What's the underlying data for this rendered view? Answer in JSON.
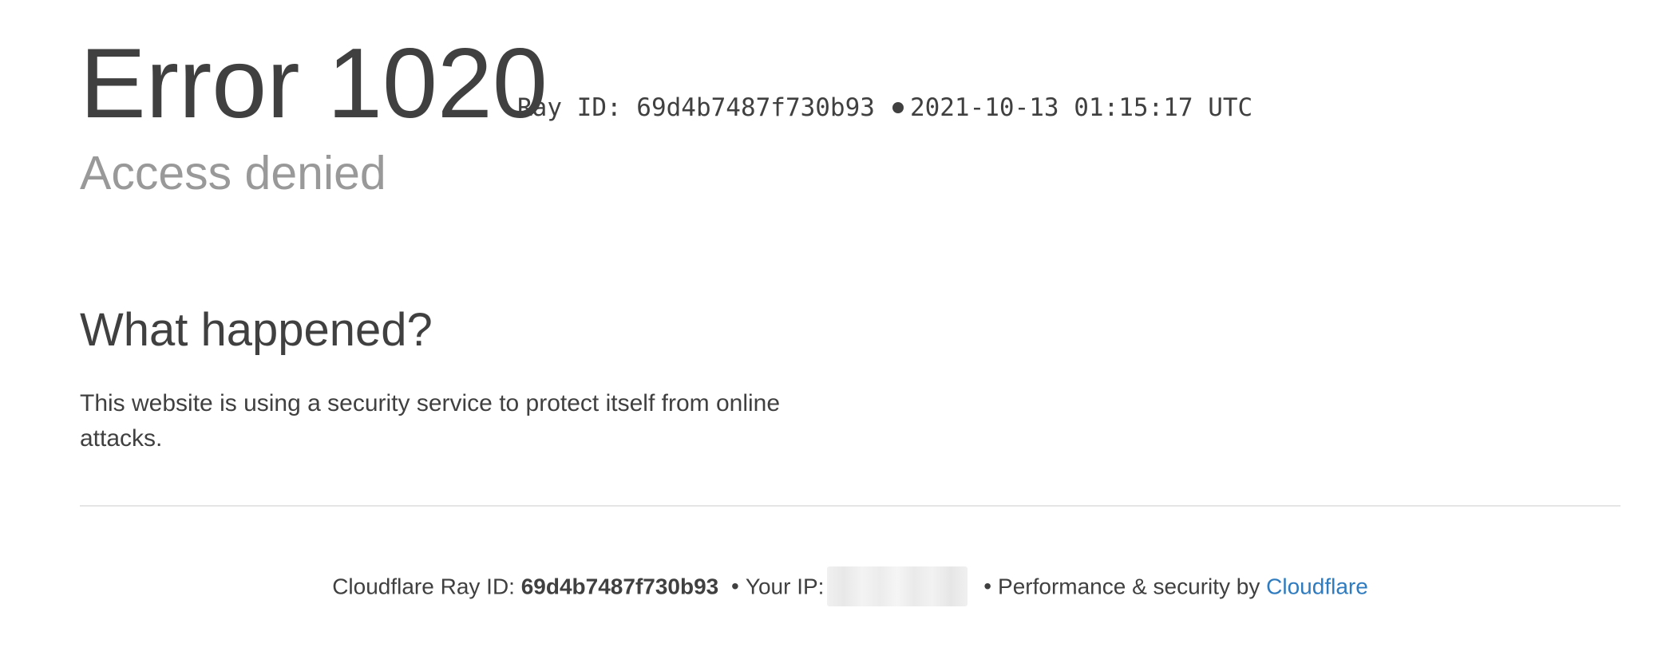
{
  "header": {
    "error_title": "Error 1020",
    "ray_label": "Ray ID: 69d4b7487f730b93",
    "timestamp": "2021-10-13 01:15:17 UTC",
    "subtitle": "Access denied"
  },
  "section": {
    "heading": "What happened?",
    "text": "This website is using a security service to protect itself from online attacks."
  },
  "footer": {
    "ray_prefix": "Cloudflare Ray ID:",
    "ray_id": "69d4b7487f730b93",
    "bullet": "•",
    "ip_label": "Your IP:",
    "perf_label": "Performance & security by",
    "cloudflare_link": "Cloudflare"
  },
  "colors": {
    "text": "#404040",
    "subtitle": "#999999",
    "link": "#2f7bbf",
    "divider": "#e5e5e5"
  }
}
